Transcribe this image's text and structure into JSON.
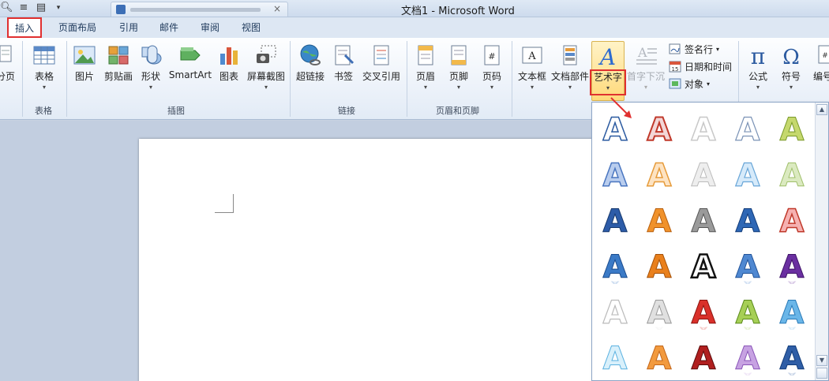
{
  "window": {
    "title": "文档1 - Microsoft Word"
  },
  "quick_access": {
    "icons": [
      "preview-icon",
      "list-icon",
      "comment-icon",
      "dropdown-icon"
    ]
  },
  "tabs": [
    {
      "label": "插入",
      "active": true
    },
    {
      "label": "页面布局"
    },
    {
      "label": "引用"
    },
    {
      "label": "邮件"
    },
    {
      "label": "审阅"
    },
    {
      "label": "视图"
    }
  ],
  "ribbon": {
    "groups": {
      "table": {
        "label": "表格"
      },
      "illustrations": {
        "label": "插图"
      },
      "links": {
        "label": "链接"
      },
      "header_footer": {
        "label": "页眉和页脚"
      }
    },
    "buttons": {
      "page_break": "分页",
      "table": "表格",
      "picture": "图片",
      "clipart": "剪贴画",
      "shapes": "形状",
      "smartart": "SmartArt",
      "chart": "图表",
      "screenshot": "屏幕截图",
      "hyperlink": "超链接",
      "bookmark": "书签",
      "crossref": "交叉引用",
      "header": "页眉",
      "footer": "页脚",
      "page_number": "页码",
      "textbox": "文本框",
      "quickparts": "文档部件",
      "wordart": "艺术字",
      "dropcap": "首字下沉",
      "equation": "公式",
      "symbol": "符号",
      "numbering": "编号"
    },
    "small_buttons": {
      "signature_line": "签名行",
      "date_time": "日期和时间",
      "object": "对象"
    }
  },
  "wordart_gallery": {
    "glyph": "A",
    "rows": 6,
    "columns": 5
  },
  "colors": {
    "highlight_red": "#e03030",
    "ribbon_blue": "#1e395b"
  }
}
